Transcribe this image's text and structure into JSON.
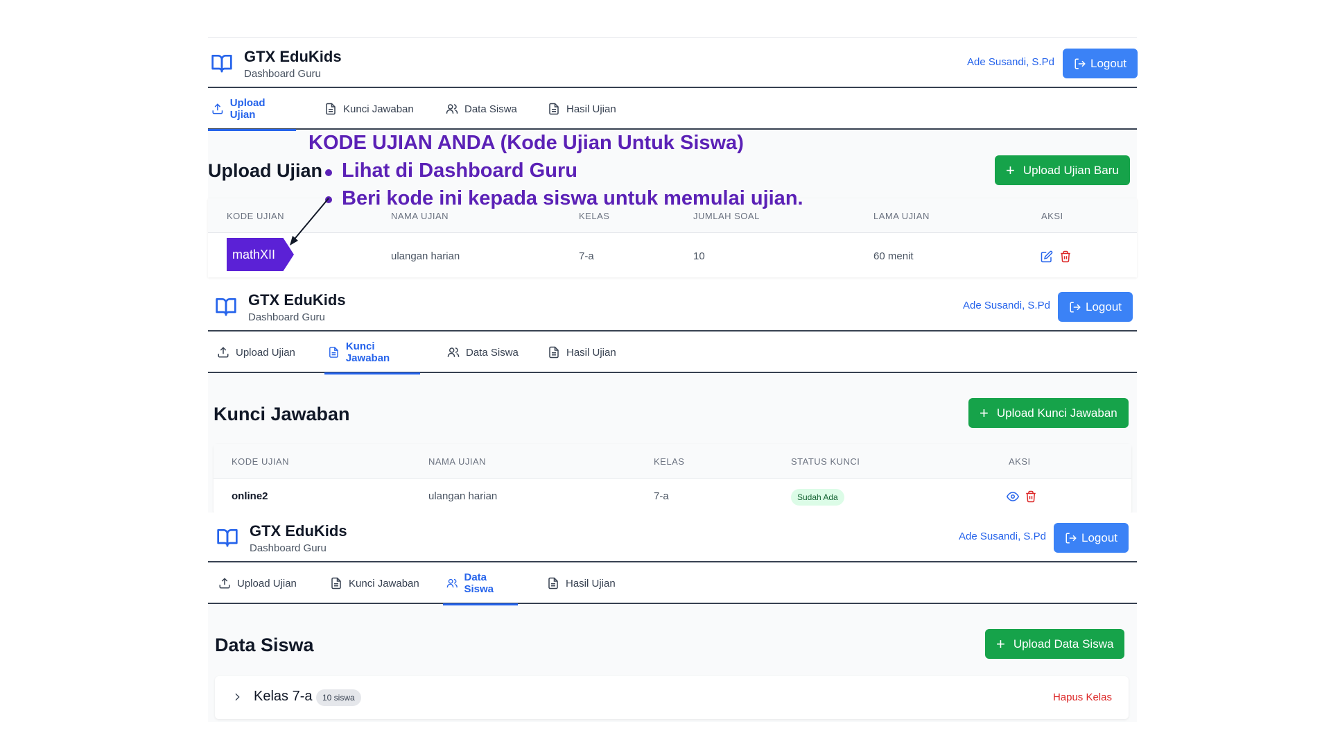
{
  "app": {
    "title": "GTX EduKids",
    "subtitle": "Dashboard Guru",
    "user": "Ade Susandi, S.Pd",
    "logout_label": "Logout"
  },
  "tabs": [
    "Upload Ujian",
    "Kunci Jawaban",
    "Data Siswa",
    "Hasil Ujian"
  ],
  "annotation": {
    "heading": "KODE UJIAN ANDA (Kode Ujian Untuk Siswa)",
    "bullet1": "Lihat di Dashboard Guru",
    "bullet2": "Beri kode ini kepada siswa untuk memulai ujian."
  },
  "upload": {
    "title": "Upload Ujian",
    "button": "Upload Ujian Baru",
    "columns": [
      "KODE UJIAN",
      "NAMA UJIAN",
      "KELAS",
      "JUMLAH SOAL",
      "LAMA UJIAN",
      "AKSI"
    ],
    "row": {
      "kode": "mathXII",
      "nama": "ulangan harian",
      "kelas": "7-a",
      "jumlah": "10",
      "lama": "60 menit"
    }
  },
  "kunci": {
    "title": "Kunci Jawaban",
    "button": "Upload Kunci Jawaban",
    "columns": [
      "KODE UJIAN",
      "NAMA UJIAN",
      "KELAS",
      "STATUS KUNCI",
      "AKSI"
    ],
    "row": {
      "kode": "online2",
      "nama": "ulangan harian",
      "kelas": "7-a",
      "status": "Sudah Ada"
    }
  },
  "siswa": {
    "title": "Data Siswa",
    "button": "Upload Data Siswa",
    "class_name": "Kelas 7-a",
    "class_count": "10 siswa",
    "delete_class": "Hapus Kelas"
  },
  "colors": {
    "primary": "#3b82f6",
    "green": "#16a34a",
    "annotation": "#5b21b6",
    "danger": "#dc2626"
  }
}
